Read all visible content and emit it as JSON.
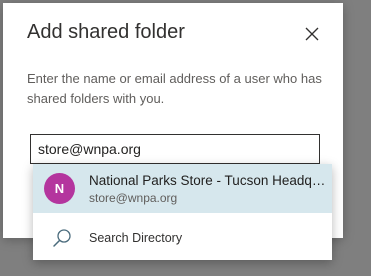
{
  "dialog": {
    "title": "Add shared folder",
    "instruction": "Enter the name or email address of a user who has shared folders with you.",
    "close_icon": "close-icon"
  },
  "input": {
    "value": "store@wnpa.org"
  },
  "dropdown": {
    "suggestion": {
      "initial": "N",
      "name": "National Parks Store - Tucson Headquarters",
      "email": "store@wnpa.org",
      "avatar_color": "#b4359e",
      "highlight_color": "#d6e7ed"
    },
    "search_directory": {
      "label": "Search Directory",
      "icon": "search-icon"
    }
  }
}
